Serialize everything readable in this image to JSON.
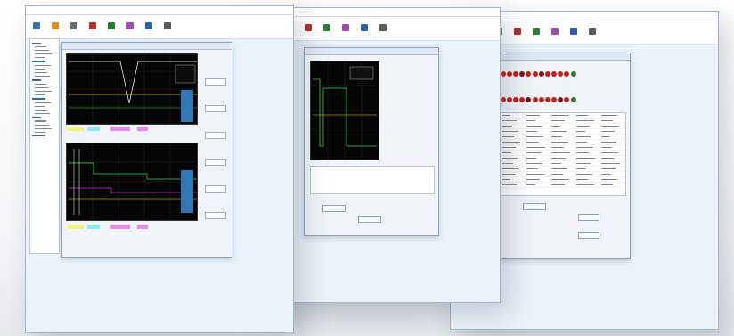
{
  "colors": {
    "window_bg": "#eaf3fb",
    "scope_bg": "#050505",
    "trace_yellow": "#e8e000",
    "trace_green": "#3fd14b",
    "trace_white": "#ffffff",
    "trace_magenta": "#d02cd0",
    "trace_cyan": "#2fd0e0",
    "led_red": "#c0201a",
    "led_dark": "#6b1a14",
    "led_green": "#2c7a2c",
    "chip_yellow": "#f2f27a",
    "chip_cyan": "#8ee9ee",
    "chip_magenta": "#e28ee8"
  },
  "toolbar_icons": [
    {
      "name": "connect-icon",
      "color": "#3b6fb0"
    },
    {
      "name": "oscilloscope-icon",
      "color": "#e08a1c"
    },
    {
      "name": "settings-icon",
      "color": "#6b6b6b"
    },
    {
      "name": "io-icon",
      "color": "#b0302a"
    },
    {
      "name": "table-icon",
      "color": "#2d7d3a"
    },
    {
      "name": "chart-icon",
      "color": "#a04bb0"
    },
    {
      "name": "save-icon",
      "color": "#2f5fa8"
    },
    {
      "name": "help-icon",
      "color": "#5b5b5b"
    }
  ],
  "led_rows": [
    [
      "#c0201a",
      "#c0201a",
      "#c0201a",
      "#6b1a14",
      "#c0201a",
      "#c0201a",
      "#6b1a14",
      "#c0201a",
      "#c0201a",
      "#c0201a",
      "#c0201a",
      "#2c7a2c"
    ],
    [
      "#c0201a",
      "#c0201a",
      "#c0201a",
      "#c0201a",
      "#6b1a14",
      "#c0201a",
      "#c0201a",
      "#c0201a",
      "#c0201a",
      "#6b1a14",
      "#c0201a",
      "#2c7a2c"
    ]
  ]
}
